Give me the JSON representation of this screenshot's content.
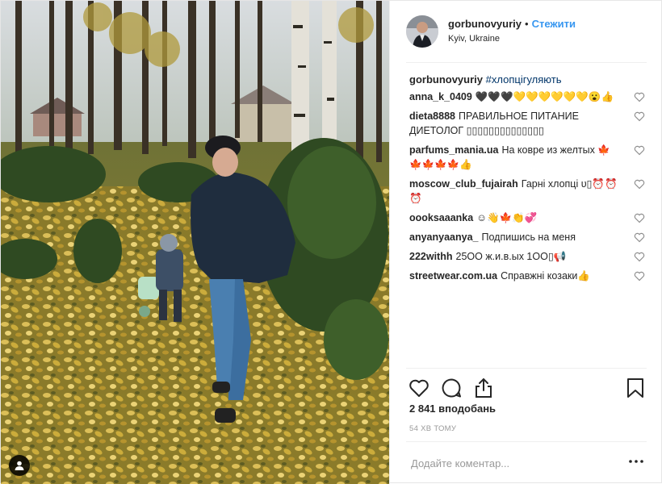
{
  "header": {
    "username": "gorbunovyuriy",
    "separator": "•",
    "follow_label": "Стежити",
    "location": "Kyiv, Ukraine"
  },
  "caption": {
    "username": "gorbunovyuriy",
    "text": "#хлопцігуляють"
  },
  "comments": [
    {
      "user": "anna_k_0409",
      "text": "🖤🖤🖤💛💛💛💛💛💛😮👍"
    },
    {
      "user": "dieta8888",
      "text": "ПРАВИЛЬНОЕ ПИТАНИЕ ДИЕТОЛОГ ▯▯▯▯▯▯▯▯▯▯▯▯▯▯"
    },
    {
      "user": "parfums_mania.ua",
      "text": "На ковре из желтых 🍁🍁🍁🍁🍁👍"
    },
    {
      "user": "moscow_club_fujairah",
      "text": "Гарні хлопці ᴜ▯⏰⏰⏰"
    },
    {
      "user": "oooksaaanka",
      "text": "☺👋🍁👏💞"
    },
    {
      "user": "anyanyaanya_",
      "text": "Подпишись на меня"
    },
    {
      "user": "222withh",
      "text": "25OO ж.и.в.ых 1OO▯📢"
    },
    {
      "user": "streetwear.com.ua",
      "text": "Справжні козаки👍"
    }
  ],
  "likes": "2 841 вподобань",
  "timestamp": "54 ХВ ТОМУ",
  "add_comment": {
    "placeholder": "Додайте коментар..."
  },
  "icons": {
    "like": "heart-icon",
    "comment": "comment-bubble-icon",
    "share": "share-icon",
    "save": "bookmark-icon",
    "more": "more-options-icon",
    "tag": "user-tag-icon"
  },
  "colors": {
    "follow": "#3897f0",
    "hashtag": "#003569",
    "muted": "#999999",
    "border": "#efefef"
  }
}
